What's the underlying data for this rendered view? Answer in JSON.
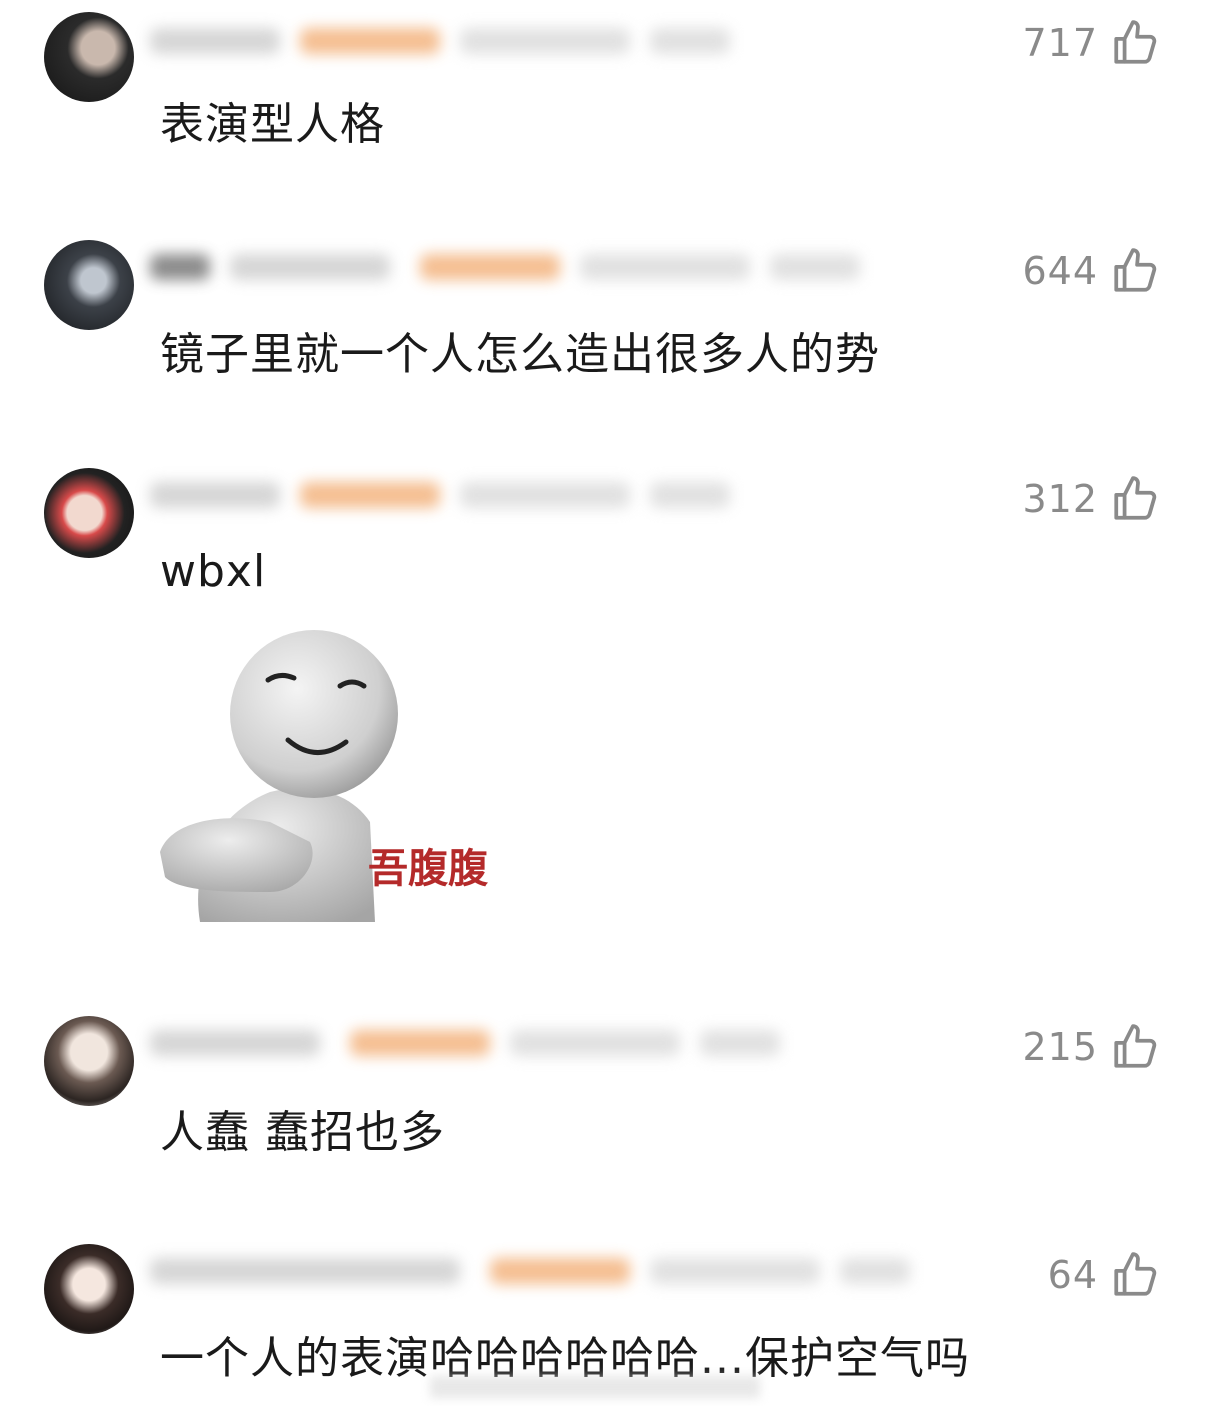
{
  "comments": [
    {
      "likes": "717",
      "text": "表演型人格"
    },
    {
      "likes": "644",
      "text": "镜子里就一个人怎么造出很多人的势"
    },
    {
      "likes": "312",
      "text": "wbxl",
      "sticker_text": "吾腹腹"
    },
    {
      "likes": "215",
      "text": "人蠢 蠢招也多"
    },
    {
      "likes": "64",
      "text": "一个人的表演哈哈哈哈哈哈...保护空气吗"
    }
  ],
  "icons": {
    "like": "thumbs-up-icon",
    "avatar": "avatar"
  },
  "colors": {
    "text": "#1a1a1a",
    "likes": "#8a8a8a",
    "badge": "#f3b37e",
    "sticker_text": "#b42a2a"
  }
}
